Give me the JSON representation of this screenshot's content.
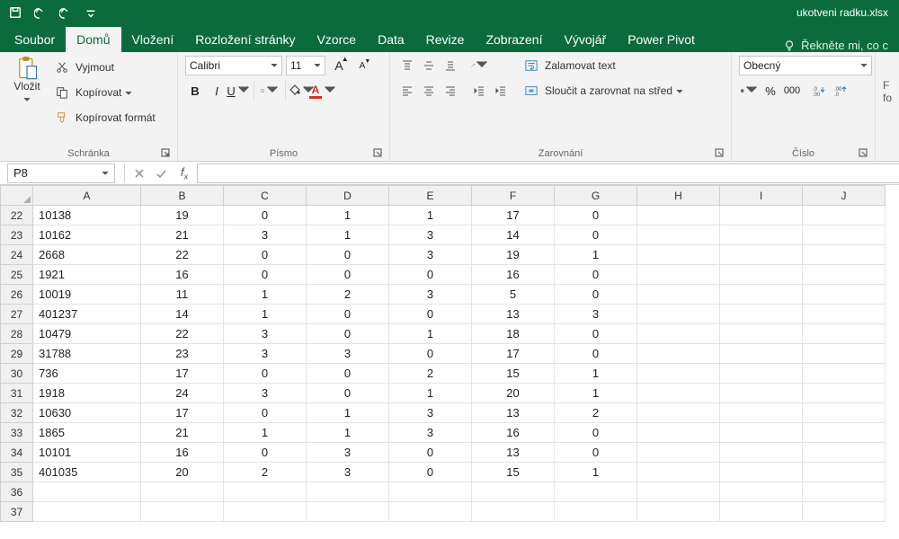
{
  "title": "ukotveni radku.xlsx",
  "tabs": [
    "Soubor",
    "Domů",
    "Vložení",
    "Rozložení stránky",
    "Vzorce",
    "Data",
    "Revize",
    "Zobrazení",
    "Vývojář",
    "Power Pivot"
  ],
  "active_tab": 1,
  "tell_me": "Řekněte mi, co c",
  "ribbon": {
    "clipboard": {
      "paste": "Vložit",
      "cut": "Vyjmout",
      "copy": "Kopírovat",
      "format_painter": "Kopírovat formát",
      "label": "Schránka"
    },
    "font": {
      "name": "Calibri",
      "size": "11",
      "label": "Písmo"
    },
    "alignment": {
      "wrap": "Zalamovat text",
      "merge": "Sloučit a zarovnat na střed",
      "label": "Zarovnání"
    },
    "number": {
      "format": "Obecný",
      "label": "Číslo"
    },
    "right_stub": "F\nfo"
  },
  "namebox": "P8",
  "formula": "",
  "columns": [
    "A",
    "B",
    "C",
    "D",
    "E",
    "F",
    "G",
    "H",
    "I",
    "J"
  ],
  "row_start": 22,
  "chart_data": {
    "type": "table",
    "title": "",
    "columns": [
      "A",
      "B",
      "C",
      "D",
      "E",
      "F",
      "G"
    ],
    "rows": [
      [
        "10138",
        19,
        0,
        1,
        1,
        17,
        0
      ],
      [
        "10162",
        21,
        3,
        1,
        3,
        14,
        0
      ],
      [
        "2668",
        22,
        0,
        0,
        3,
        19,
        1
      ],
      [
        "1921",
        16,
        0,
        0,
        0,
        16,
        0
      ],
      [
        "10019",
        11,
        1,
        2,
        3,
        5,
        0
      ],
      [
        "401237",
        14,
        1,
        0,
        0,
        13,
        3
      ],
      [
        "10479",
        22,
        3,
        0,
        1,
        18,
        0
      ],
      [
        "31788",
        23,
        3,
        3,
        0,
        17,
        0
      ],
      [
        "736",
        17,
        0,
        0,
        2,
        15,
        1
      ],
      [
        "1918",
        24,
        3,
        0,
        1,
        20,
        1
      ],
      [
        "10630",
        17,
        0,
        1,
        3,
        13,
        2
      ],
      [
        "1865",
        21,
        1,
        1,
        3,
        16,
        0
      ],
      [
        "10101",
        16,
        0,
        3,
        0,
        13,
        0
      ],
      [
        "401035",
        20,
        2,
        3,
        0,
        15,
        1
      ]
    ]
  }
}
